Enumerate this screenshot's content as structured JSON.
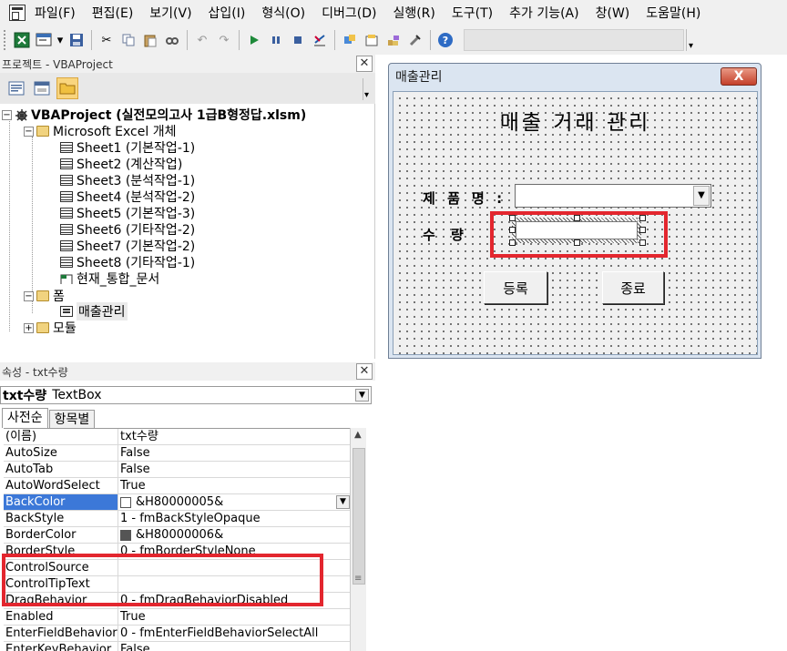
{
  "menu": {
    "items": [
      "파일(F)",
      "편집(E)",
      "보기(V)",
      "삽입(I)",
      "형식(O)",
      "디버그(D)",
      "실행(R)",
      "도구(T)",
      "추가 기능(A)",
      "창(W)",
      "도움말(H)"
    ]
  },
  "toolbar": {
    "icons": [
      "excel-icon",
      "insert-userform-icon",
      "save-icon",
      "cut-icon",
      "copy-icon",
      "paste-icon",
      "find-icon",
      "undo-icon",
      "redo-icon",
      "run-icon",
      "break-icon",
      "reset-icon",
      "design-mode-icon",
      "project-explorer-icon",
      "properties-icon",
      "object-browser-icon",
      "toolbox-icon",
      "help-icon"
    ]
  },
  "project_panel": {
    "title": "프로젝트 - VBAProject",
    "root": "VBAProject (실전모의고사 1급B형정답.xlsm)",
    "excel_objects_folder": "Microsoft Excel 개체",
    "sheets": [
      "Sheet1 (기본작업-1)",
      "Sheet2 (계산작업)",
      "Sheet3 (분석작업-1)",
      "Sheet4 (분석작업-2)",
      "Sheet5 (기본작업-3)",
      "Sheet6 (기타작업-2)",
      "Sheet7 (기본작업-2)",
      "Sheet8 (기타작업-1)"
    ],
    "workbook": "현재_통합_문서",
    "forms_folder": "폼",
    "form_item": "매출관리",
    "modules_folder": "모듈"
  },
  "properties_panel": {
    "title": "속성 - txt수량",
    "object_name": "txt수량",
    "object_type": "TextBox",
    "tabs": [
      "사전순",
      "항목별"
    ],
    "rows": [
      {
        "name": "(이름)",
        "value": "txt수량"
      },
      {
        "name": "AutoSize",
        "value": "False"
      },
      {
        "name": "AutoTab",
        "value": "False"
      },
      {
        "name": "AutoWordSelect",
        "value": "True"
      },
      {
        "name": "BackColor",
        "value": "&H80000005&"
      },
      {
        "name": "BackStyle",
        "value": "1 - fmBackStyleOpaque"
      },
      {
        "name": "BorderColor",
        "value": "&H80000006&"
      },
      {
        "name": "BorderStyle",
        "value": "0 - fmBorderStyleNone"
      },
      {
        "name": "ControlSource",
        "value": ""
      },
      {
        "name": "ControlTipText",
        "value": ""
      },
      {
        "name": "DragBehavior",
        "value": "0 - fmDragBehaviorDisabled"
      },
      {
        "name": "Enabled",
        "value": "True"
      },
      {
        "name": "EnterFieldBehavior",
        "value": "0 - fmEnterFieldBehaviorSelectAll"
      },
      {
        "name": "EnterKeyBehavior",
        "value": "False"
      }
    ],
    "colors": {
      "backcolor_swatch": "#ffffff",
      "bordercolor_swatch": "#555555",
      "selected_row": "#3c78d8"
    }
  },
  "userform": {
    "title": "매출관리",
    "close_label": "X",
    "heading": "매출 거래 관리",
    "product_label": "제 품 명 :",
    "quantity_label": "수   량",
    "register_button": "등록",
    "close_button": "종료",
    "highlight_color": "#e3262e"
  }
}
